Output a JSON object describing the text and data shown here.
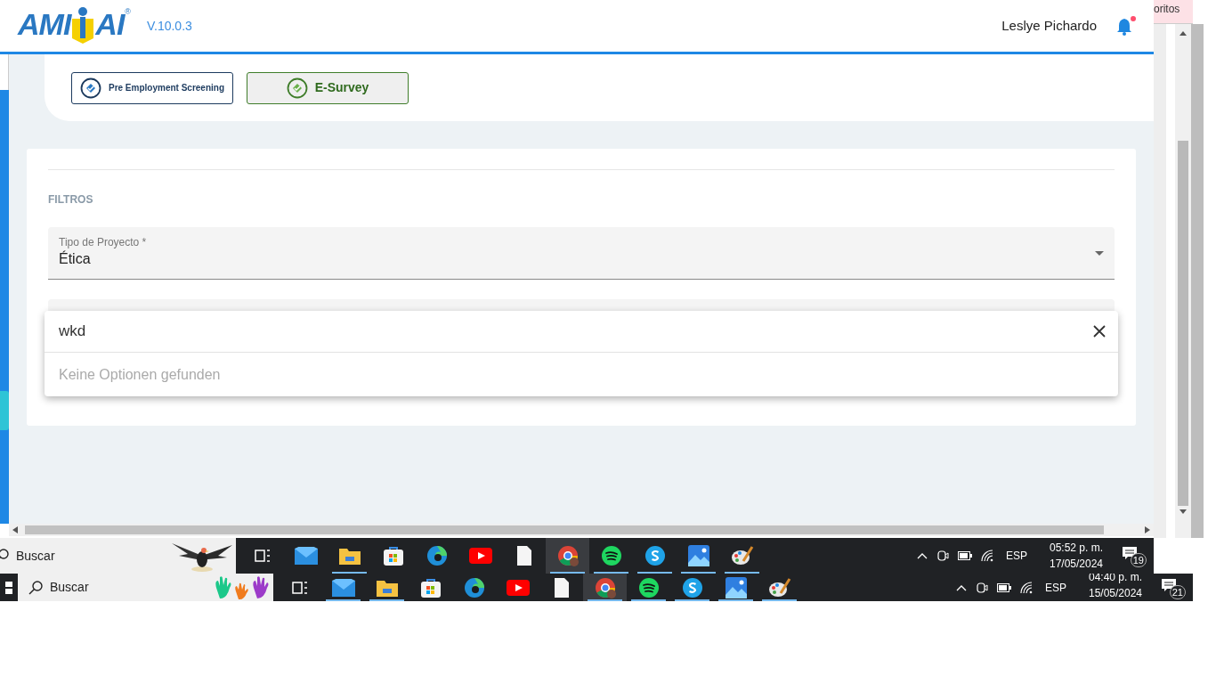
{
  "browser_tab": {
    "label": "oritos"
  },
  "header": {
    "logo_left": "AMI",
    "logo_right": "AI",
    "registered": "®",
    "version": "V.10.0.3",
    "user_name": "Leslye Pichardo",
    "has_notification": true
  },
  "modules": [
    {
      "label": "Pre Employment Screening",
      "selected": false
    },
    {
      "label": "E-Survey",
      "selected": true
    }
  ],
  "filters": {
    "heading": "FILTROS",
    "fields": [
      {
        "label": "Tipo de Proyecto *",
        "value": "Ética"
      }
    ]
  },
  "dropdown": {
    "search_value": "wkd",
    "empty_message": "Keine Optionen gefunden"
  },
  "taskbars": [
    {
      "search_placeholder": "Buscar",
      "language": "ESP",
      "time": "05:52 p. m.",
      "date": "17/05/2024",
      "notifications": "19",
      "apps": [
        {
          "kind": "taskview",
          "running": false,
          "selected": false
        },
        {
          "kind": "mail",
          "running": false,
          "selected": false
        },
        {
          "kind": "folder",
          "running": true,
          "selected": false
        },
        {
          "kind": "store",
          "running": false,
          "selected": false
        },
        {
          "kind": "edge",
          "running": false,
          "selected": false
        },
        {
          "kind": "youtube",
          "running": false,
          "selected": false
        },
        {
          "kind": "file",
          "running": false,
          "selected": false
        },
        {
          "kind": "chrome",
          "running": true,
          "selected": true
        },
        {
          "kind": "spotify",
          "running": true,
          "selected": false
        },
        {
          "kind": "skype",
          "running": true,
          "selected": false
        },
        {
          "kind": "photos",
          "running": true,
          "selected": false
        },
        {
          "kind": "paint",
          "running": true,
          "selected": false
        }
      ]
    },
    {
      "search_placeholder": "Buscar",
      "language": "ESP",
      "time": "04:40 p. m.",
      "date": "15/05/2024",
      "notifications": "21",
      "apps": [
        {
          "kind": "taskview",
          "running": false,
          "selected": false
        },
        {
          "kind": "mail",
          "running": true,
          "selected": false
        },
        {
          "kind": "folder",
          "running": true,
          "selected": false
        },
        {
          "kind": "store",
          "running": false,
          "selected": false
        },
        {
          "kind": "edge",
          "running": false,
          "selected": false
        },
        {
          "kind": "youtube",
          "running": false,
          "selected": false
        },
        {
          "kind": "file",
          "running": false,
          "selected": false
        },
        {
          "kind": "chrome",
          "running": true,
          "selected": true
        },
        {
          "kind": "spotify",
          "running": true,
          "selected": false
        },
        {
          "kind": "skype",
          "running": true,
          "selected": false
        },
        {
          "kind": "photos",
          "running": true,
          "selected": false
        },
        {
          "kind": "paint",
          "running": true,
          "selected": false
        }
      ]
    }
  ]
}
